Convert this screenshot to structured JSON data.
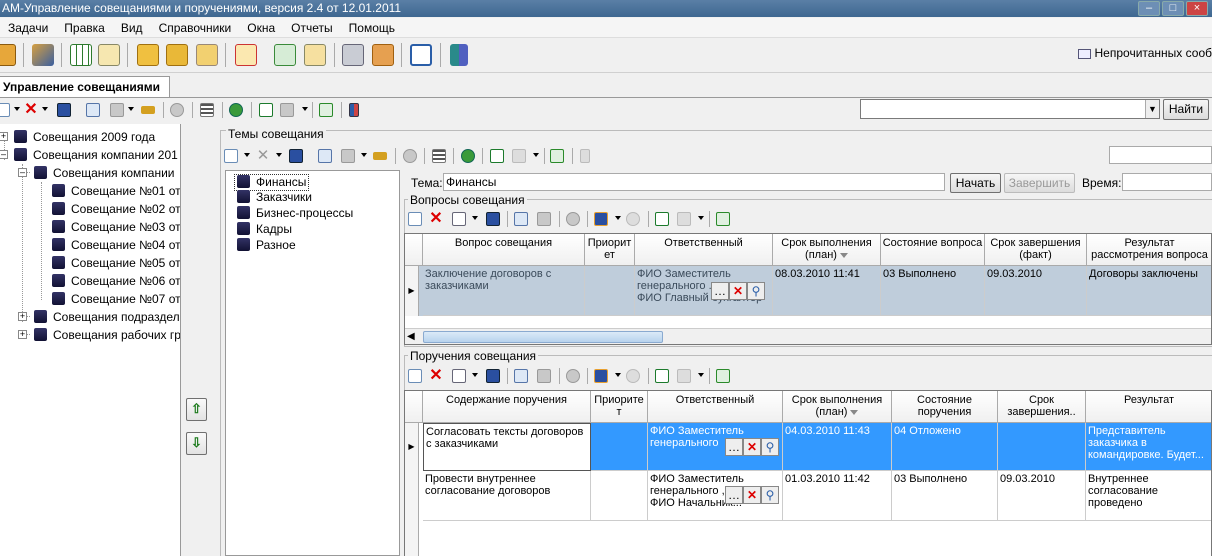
{
  "window": {
    "title": "АМ-Управление совещаниями и поручениями, версия 2.4 от 12.01.2011"
  },
  "menu": [
    "Задачи",
    "Правка",
    "Вид",
    "Справочники",
    "Окна",
    "Отчеты",
    "Помощь"
  ],
  "status": {
    "unread": "Непрочитанных сооб"
  },
  "tab": {
    "label": "Управление совещаниями"
  },
  "search": {
    "value": "",
    "find_label": "Найти"
  },
  "tree": {
    "nodes": [
      {
        "label": "Совещания 2009 года"
      },
      {
        "label": "Совещания компании 201"
      },
      {
        "label": "Совещания компании"
      },
      {
        "label": "Совещание №01 от"
      },
      {
        "label": "Совещание №02 от"
      },
      {
        "label": "Совещание №03 от"
      },
      {
        "label": "Совещание №04 от"
      },
      {
        "label": "Совещание №05 от"
      },
      {
        "label": "Совещание №06 от"
      },
      {
        "label": "Совещание №07 от"
      },
      {
        "label": "Совещания подраздел"
      },
      {
        "label": "Совещания рабочих гр"
      }
    ]
  },
  "topics_group": {
    "label": "Темы совещания",
    "items": [
      "Финансы",
      "Заказчики",
      "Бизнес-процессы",
      "Кадры",
      "Разное"
    ]
  },
  "topic_form": {
    "theme_label": "Тема:",
    "theme_value": "Финансы",
    "start_label": "Начать",
    "finish_label": "Завершить",
    "time_label": "Время:"
  },
  "questions": {
    "label": "Вопросы совещания",
    "headers": [
      "Вопрос совещания",
      "Приорит ет",
      "Ответственный",
      "Срок выполнения (план)",
      "Состояние вопроса",
      "Срок завершения (факт)",
      "Результат рассмотрения вопроса"
    ],
    "rows": [
      {
        "question": "Заключение договоров с заказчиками",
        "priority": "",
        "responsible_1": "ФИО Заместитель",
        "responsible_2": "генерального .",
        "responsible_3": "ФИО Главный бухгалтер",
        "plan": "08.03.2010 11:41",
        "state": "03 Выполнено",
        "fact": "09.03.2010",
        "result": "Договоры заключены"
      }
    ]
  },
  "orders": {
    "label": "Поручения совещания",
    "headers": [
      "Содержание поручения",
      "Приорите т",
      "Ответственный",
      "Срок выполнения (план)",
      "Состояние поручения",
      "Срок завершения..",
      "Результат"
    ],
    "rows": [
      {
        "content": "Согласовать тексты договоров с заказчиками",
        "priority": "",
        "responsible_1": "ФИО Заместитель",
        "responsible_2": "генерального",
        "responsible_3": "",
        "plan": "04.03.2010 11:43",
        "state": "04 Отложено",
        "fact": "",
        "result": "Представитель заказчика в командировке. Будет..."
      },
      {
        "content": "Провести внутреннее согласование договоров",
        "priority": "",
        "responsible_1": "ФИО Заместитель",
        "responsible_2": "генерального ,",
        "responsible_3": "ФИО Начальник...",
        "plan": "01.03.2010 11:42",
        "state": "03 Выполнено",
        "fact": "09.03.2010",
        "result": "Внутреннее согласование проведено"
      }
    ]
  },
  "colors": {
    "selection": "#3399ff",
    "row_highlight": "#bfcddb"
  }
}
